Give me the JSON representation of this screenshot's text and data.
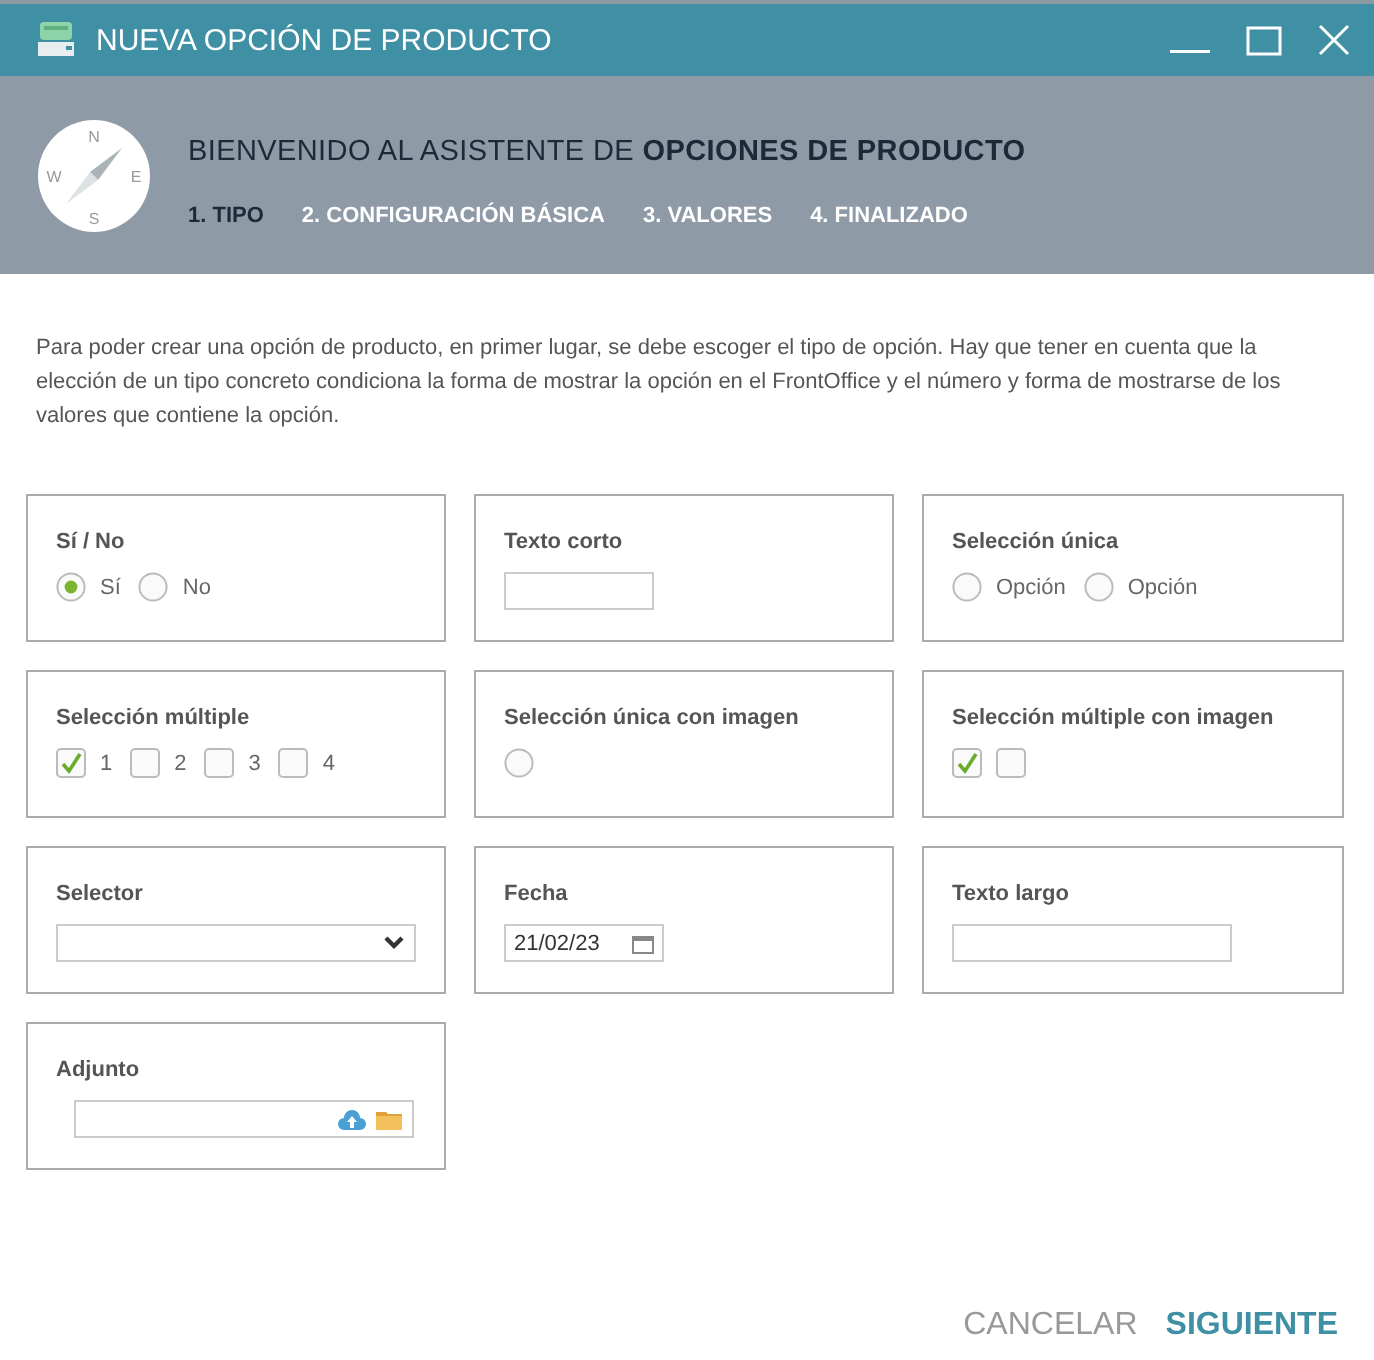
{
  "window": {
    "title": "NUEVA OPCIÓN DE PRODUCTO"
  },
  "header": {
    "compass": [
      "N",
      "E",
      "S",
      "W"
    ],
    "heading": "BIENVENIDO AL ASISTENTE DE **OPCIONES DE PRODUCTO**",
    "steps": [
      {
        "label": "1. TIPO",
        "selected": true
      },
      {
        "label": "2. CONFIGURACIÓN BÁSICA",
        "selected": false
      },
      {
        "label": "3. VALORES",
        "selected": false
      },
      {
        "label": "4. FINALIZADO",
        "selected": false
      }
    ]
  },
  "intro": "Para poder crear una opción de producto, en primer lugar, se debe escoger el tipo de opción. Hay que tener en cuenta que la elección de un tipo concreto condiciona la forma de mostrar la opción en el FrontOffice y el número y forma de mostrarse de los valores que contiene la opción.",
  "cards": [
    {
      "title": "Sí / No",
      "kind": "radios",
      "options": [
        {
          "label": "Sí",
          "selected": true
        },
        {
          "label": "No",
          "selected": false
        }
      ]
    },
    {
      "title": "Texto corto",
      "kind": "text"
    },
    {
      "title": "Selección única",
      "kind": "radios",
      "options": [
        {
          "label": "Opción",
          "selected": false
        },
        {
          "label": "Opción",
          "selected": false
        }
      ]
    },
    {
      "title": "Selección múltiple",
      "kind": "checks",
      "options": [
        {
          "label": "1",
          "checked": true
        },
        {
          "label": "2",
          "checked": false
        },
        {
          "label": "3",
          "checked": false
        },
        {
          "label": "4",
          "checked": false
        }
      ]
    },
    {
      "title": "Selección única con imagen",
      "kind": "radios",
      "options": [
        {
          "selected": false
        }
      ]
    },
    {
      "title": "Selección múltiple con imagen",
      "kind": "checks",
      "options": [
        {
          "checked": true
        },
        {
          "checked": false
        }
      ]
    },
    {
      "title": "Selector",
      "kind": "select"
    },
    {
      "title": "Fecha",
      "kind": "date",
      "value": "21/02/23"
    },
    {
      "title": "Texto largo",
      "kind": "longtext"
    },
    {
      "title": "Adjunto",
      "kind": "file"
    }
  ],
  "buttons": [
    {
      "label": "CANCELAR",
      "kind": "secondary"
    },
    {
      "label": "SIGUIENTE",
      "kind": "primary"
    }
  ]
}
